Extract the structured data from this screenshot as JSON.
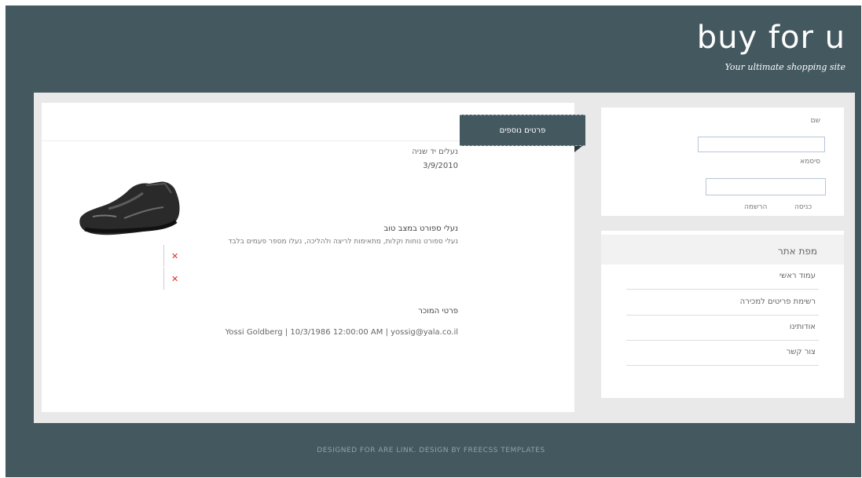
{
  "header": {
    "site_title": "buy for u",
    "tagline": "Your ultimate shopping site"
  },
  "post": {
    "ribbon_label": "פרטים נוספים",
    "title": "נעלים יד שניה",
    "date": "3/9/2010",
    "item_heading": "נעלי ספורט במצב טוב",
    "item_description": "נעלי ספורט נוחות וקלות, מתאימות לריצה ולהליכה, נעלו מספר פעמים בלבד",
    "seller_heading": "פרטי המוכר",
    "seller_details": "Yossi Goldberg | 10/3/1986 12:00:00 AM | yossig@yala.co.il"
  },
  "login": {
    "username_label": "שם",
    "username_value": "",
    "password_label": "סיסמא",
    "password_value": "",
    "login_label": "כניסה",
    "register_label": "הרשמה"
  },
  "nav": {
    "title": "מפת אתר",
    "items": [
      {
        "label": "עמוד ראשי"
      },
      {
        "label": "רשימת פריטים למכירה"
      },
      {
        "label": "אודותינו"
      },
      {
        "label": "צור קשר"
      }
    ]
  },
  "footer": {
    "text": "DESIGNED FOR ARE LINK. DESIGN BY FREECSS TEMPLATES"
  },
  "colors": {
    "frame": "#44585f",
    "container": "#e9e9e9",
    "broken_icon": "#d9312b"
  }
}
